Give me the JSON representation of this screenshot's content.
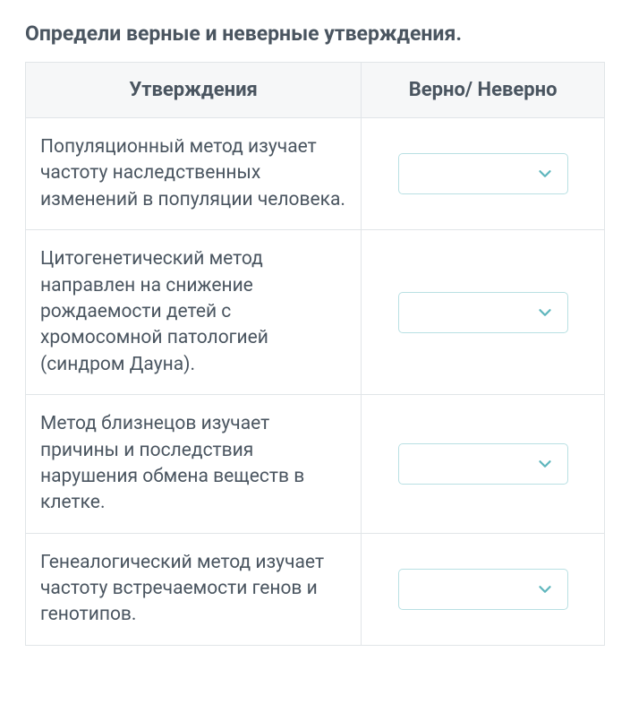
{
  "title": "Определи верные и неверные утверждения.",
  "headers": {
    "statement": "Утверждения",
    "answer": "Верно/ Неверно"
  },
  "rows": [
    {
      "statement": "Популяционный метод изучает частоту наследственных изменений в популяции человека.",
      "selected": ""
    },
    {
      "statement": "Цитогенетический метод направлен на снижение рождаемости детей с хромосомной патологией (синдром Дауна).",
      "selected": ""
    },
    {
      "statement": "Метод близнецов изучает причины и последствия нарушения обмена веществ в клетке.",
      "selected": ""
    },
    {
      "statement": "Генеалогический метод изучает частоту встречаемости генов и генотипов.",
      "selected": ""
    }
  ]
}
